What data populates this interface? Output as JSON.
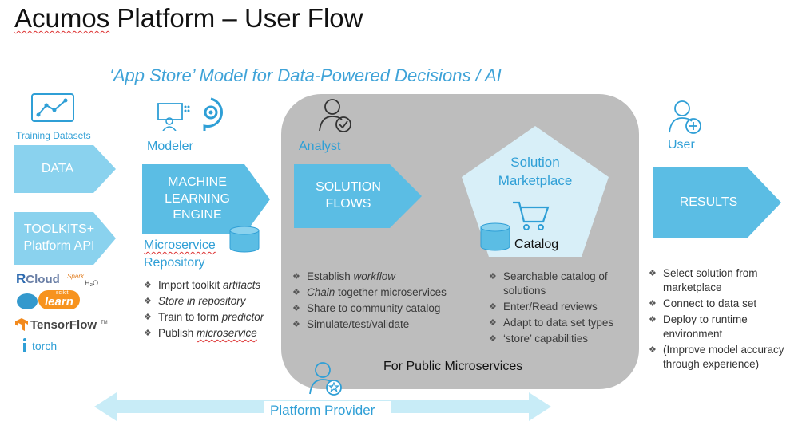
{
  "title": {
    "part1": "Acumos",
    "part2": " Platform – User Flow"
  },
  "subtitle": "‘App Store’ Model for Data-Powered Decisions / AI",
  "left": {
    "training_label": "Training Datasets",
    "data_label": "DATA",
    "toolkits_line1": "TOOLKITS+",
    "toolkits_line2": "Platform API",
    "logos": {
      "rcloud_r": "R",
      "rcloud_rest": "Cloud",
      "spark": "Spark",
      "h2o": "H₂O",
      "scikit": "scikit",
      "learn": "learn",
      "tensorflow": "TensorFlow",
      "tm": "TM",
      "torch": "torch"
    }
  },
  "modeler": {
    "role": "Modeler",
    "engine_line1": "MACHINE",
    "engine_line2": "LEARNING",
    "engine_line3": "ENGINE",
    "repo_line1": "Microservice",
    "repo_line2": "Repository",
    "bullets": [
      {
        "pre": "Import toolkit ",
        "em": "artifacts",
        "post": ""
      },
      {
        "pre": "",
        "em": "Store in repository",
        "post": ""
      },
      {
        "pre": "Train to form ",
        "em": "predictor",
        "post": ""
      },
      {
        "pre": "Publish ",
        "em": "microservice",
        "post": ""
      }
    ]
  },
  "analyst": {
    "role": "Analyst",
    "flows_line1": "SOLUTION",
    "flows_line2": "FLOWS",
    "bullets": [
      {
        "pre": "Establish ",
        "em": "workflow",
        "post": ""
      },
      {
        "pre": "",
        "em": "Chain",
        "post": " together microservices"
      },
      {
        "pre": "Share to community catalog",
        "em": "",
        "post": ""
      },
      {
        "pre": "Simulate/test/validate",
        "em": "",
        "post": ""
      }
    ]
  },
  "marketplace": {
    "line1": "Solution",
    "line2": "Marketplace",
    "catalog": "Catalog",
    "bullets": [
      "Searchable catalog of solutions",
      "Enter/Read reviews",
      "Adapt to data set types",
      "‘store’ capabilities"
    ]
  },
  "public_label": "For Public Microservices",
  "user": {
    "role": "User",
    "results": "RESULTS",
    "bullets": [
      "Select solution from marketplace",
      "Connect to data set",
      "Deploy to runtime environment",
      "(Improve model accuracy through experience)"
    ]
  },
  "provider": "Platform Provider",
  "colors": {
    "arrow": "#5bbde4",
    "arrow_light": "#8ad2ee",
    "gray_box": "#bdbdbd",
    "label_blue": "#2f9fd6",
    "pentagon": "#d8eff8",
    "provider_arrow": "#c8ecf7"
  }
}
